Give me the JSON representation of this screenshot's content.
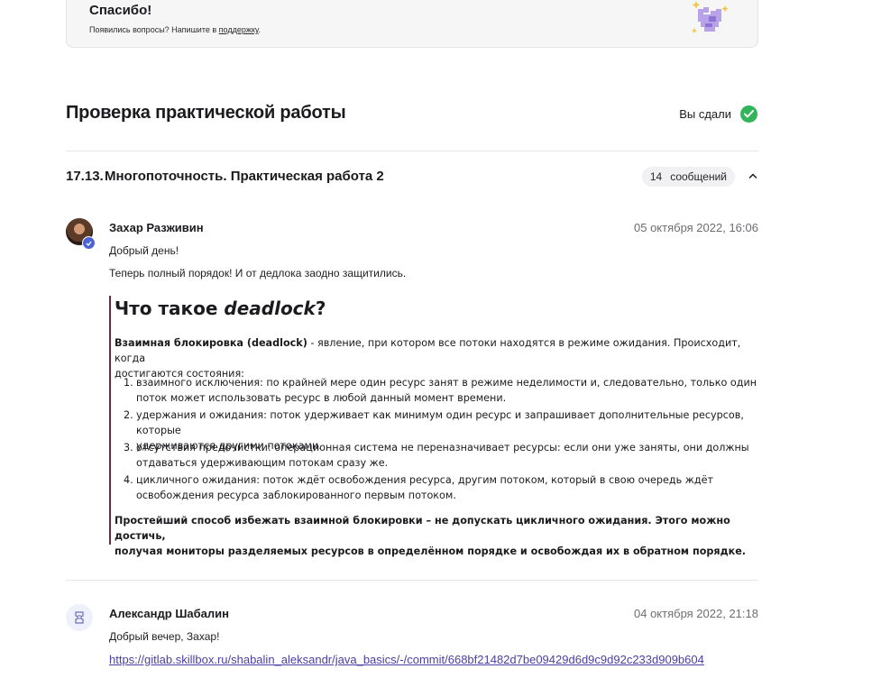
{
  "thanks": {
    "title": "Спасибо!",
    "subtitle_prefix": "Появились вопросы? Напишите в ",
    "support_link": "поддержку",
    "subtitle_suffix": "."
  },
  "section": {
    "title": "Проверка практической работы",
    "status": "Вы сдали"
  },
  "task": {
    "number": "17.13.",
    "name": "Многопоточность. Практическая работа 2",
    "message_count": "14",
    "message_label": "сообщений"
  },
  "comments": [
    {
      "author": "Захар Разживин",
      "date": "05 октября 2022, 16:06",
      "greeting": "Добрый день!",
      "text": "Теперь полный порядок! И от дедлока заодно защитились.",
      "quote": {
        "title_prefix": "Что такое ",
        "title_em": "deadlock",
        "title_suffix": "?",
        "intro_bold": "Взаимная блокировка (deadlock)",
        "intro_line1": " - явление, при котором все потоки находятся в режиме ожидания. Происходит, когда",
        "intro_line2": "достигаются состояния:",
        "items": [
          {
            "n": "1.",
            "l1": "взаимного исключения: по крайней мере один ресурс занят в режиме неделимости и, следовательно, только один",
            "l2": "поток может использовать ресурс в любой данный момент времени."
          },
          {
            "n": "2.",
            "l1": "удержания и ожидания: поток удерживает как минимум один ресурс и запрашивает дополнительные ресурсов, которые",
            "l2": "удерживаются другими потоками."
          },
          {
            "n": "3.",
            "l1": "отсутствия предочистки: операционная система не переназначивает ресурсы: если они уже заняты, они должны",
            "l2": "отдаваться удерживающим потокам сразу же."
          },
          {
            "n": "4.",
            "l1": "цикличного ожидания: поток ждёт освобождения ресурса, другим потоком, который в свою очередь ждёт",
            "l2": "освобождения ресурса заблокированного первым потоком."
          }
        ],
        "conclusion_line1": "Простейший способ избежать взаимной блокировки – не допускать цикличного ожидания. Этого можно достичь,",
        "conclusion_line2": "получая мониторы разделяемых ресурсов в определённом порядке и освобождая их в обратном порядке."
      }
    },
    {
      "author": "Александр Шабалин",
      "date": "04 октября 2022, 21:18",
      "greeting": "Добрый вечер, Захар!",
      "link": "https://gitlab.skillbox.ru/shabalin_aleksandr/java_basics/-/commit/668bf21482d7be09429d6d9c9d92c233d909b604"
    }
  ],
  "icons": {
    "heart": "pixel-heart-icon",
    "check": "check-circle-icon",
    "chevron": "chevron-up-icon",
    "verified": "verified-badge-icon",
    "ticket": "ticket-icon"
  },
  "colors": {
    "success": "#31b45a",
    "verified": "#4a64d8",
    "quote_border": "#6b2a3f",
    "link": "#4a3fa3"
  }
}
